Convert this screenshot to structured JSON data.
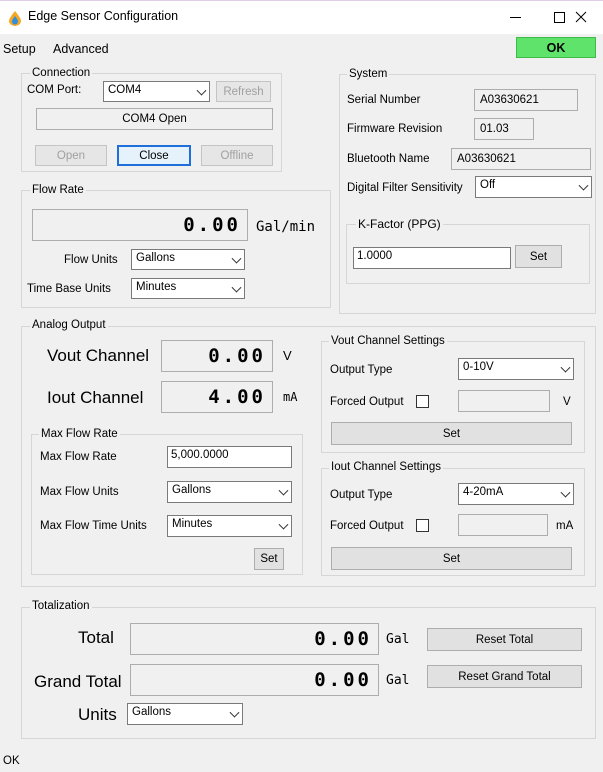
{
  "window": {
    "title": "Edge Sensor Configuration"
  },
  "menu": {
    "items": [
      "Setup",
      "Advanced"
    ],
    "ok_button": "OK"
  },
  "connection": {
    "legend": "Connection",
    "com_port_label": "COM Port:",
    "com_port_value": "COM4",
    "refresh": "Refresh",
    "status": "COM4 Open",
    "open": "Open",
    "close": "Close",
    "offline": "Offline"
  },
  "system": {
    "legend": "System",
    "serial_label": "Serial Number",
    "serial_value": "A03630621",
    "firmware_label": "Firmware Revision",
    "firmware_value": "01.03",
    "bluetooth_label": "Bluetooth Name",
    "bluetooth_value": "A03630621",
    "filter_label": "Digital Filter Sensitivity",
    "filter_value": "Off",
    "kfactor_legend": "K-Factor (PPG)",
    "kfactor_value": "1.0000",
    "kfactor_set": "Set"
  },
  "flow_rate": {
    "legend": "Flow Rate",
    "value": "0.00",
    "unit": "Gal/min",
    "flow_units_label": "Flow Units",
    "flow_units_value": "Gallons",
    "time_base_label": "Time Base Units",
    "time_base_value": "Minutes"
  },
  "analog_output": {
    "legend": "Analog Output",
    "vout_label": "Vout Channel",
    "vout_value": "0.00",
    "vout_unit": "V",
    "iout_label": "Iout Channel",
    "iout_value": "4.00",
    "iout_unit": "mA",
    "max_flow": {
      "legend": "Max Flow Rate",
      "rate_label": "Max Flow Rate",
      "rate_value": "5,000.0000",
      "units_label": "Max Flow Units",
      "units_value": "Gallons",
      "time_label": "Max Flow Time Units",
      "time_value": "Minutes",
      "set": "Set"
    },
    "vout_settings": {
      "legend": "Vout Channel Settings",
      "output_type_label": "Output Type",
      "output_type_value": "0-10V",
      "forced_label": "Forced Output",
      "forced_unit": "V",
      "set": "Set"
    },
    "iout_settings": {
      "legend": "Iout Channel Settings",
      "output_type_label": "Output Type",
      "output_type_value": "4-20mA",
      "forced_label": "Forced Output",
      "forced_unit": "mA",
      "set": "Set"
    }
  },
  "totalization": {
    "legend": "Totalization",
    "total_label": "Total",
    "total_value": "0.00",
    "total_unit": "Gal",
    "reset_total": "Reset Total",
    "grand_label": "Grand Total",
    "grand_value": "0.00",
    "grand_unit": "Gal",
    "reset_grand": "Reset Grand Total",
    "units_label": "Units",
    "units_value": "Gallons"
  },
  "status_bar": {
    "text": "OK"
  }
}
